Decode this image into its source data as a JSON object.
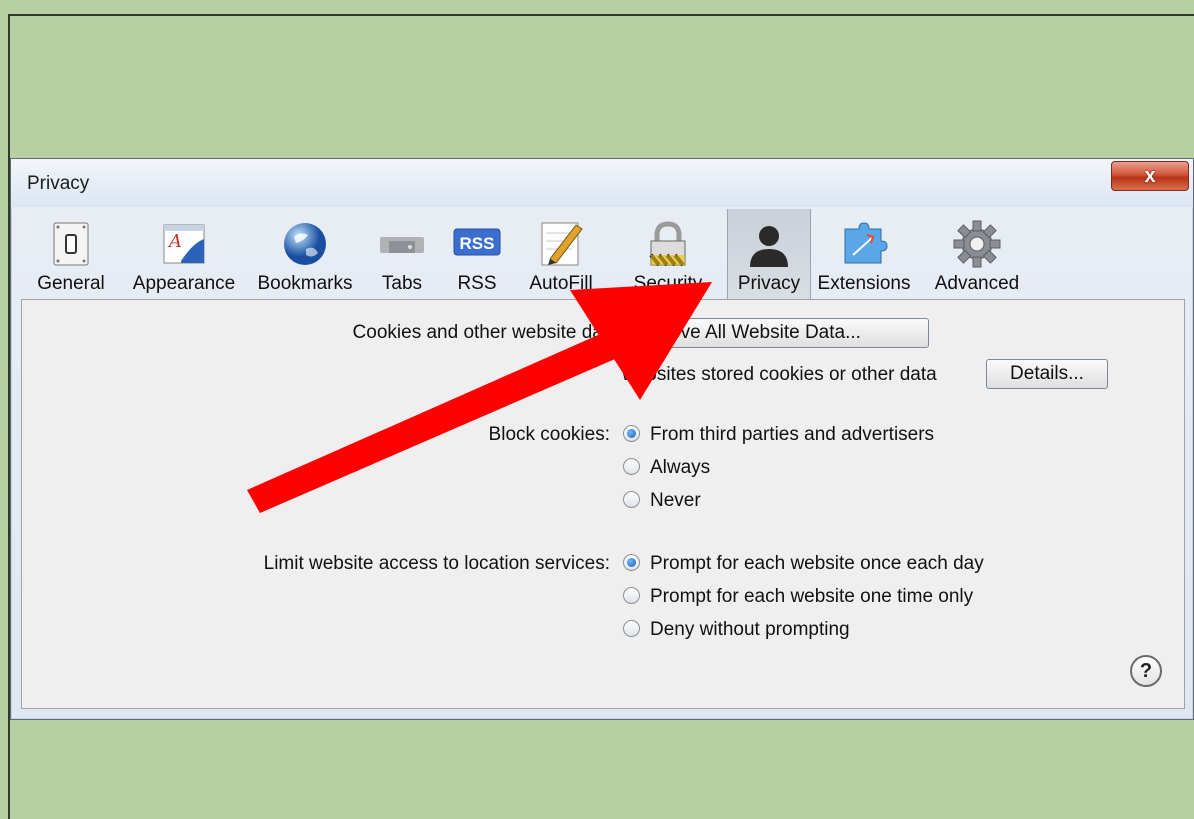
{
  "window": {
    "title": "Privacy",
    "close_glyph": "x"
  },
  "toolbar": {
    "items": [
      {
        "label": "General",
        "icon": "general-switch-icon"
      },
      {
        "label": "Appearance",
        "icon": "appearance-icon"
      },
      {
        "label": "Bookmarks",
        "icon": "globe-icon"
      },
      {
        "label": "Tabs",
        "icon": "tabs-icon"
      },
      {
        "label": "RSS",
        "icon": "rss-icon",
        "icon_text": "RSS"
      },
      {
        "label": "AutoFill",
        "icon": "autofill-pencil-icon"
      },
      {
        "label": "Security",
        "icon": "padlock-icon"
      },
      {
        "label": "Privacy",
        "icon": "person-silhouette-icon",
        "selected": true
      },
      {
        "label": "Extensions",
        "icon": "puzzle-piece-icon"
      },
      {
        "label": "Advanced",
        "icon": "gear-icon"
      }
    ]
  },
  "privacy": {
    "cookies_label": "Cookies and other website data:",
    "remove_all_button": "Remove All Website Data...",
    "stored_count_text": "websites stored cookies or other data",
    "details_button": "Details...",
    "block_cookies_label": "Block cookies:",
    "block_options": [
      {
        "label": "From third parties and advertisers",
        "selected": true
      },
      {
        "label": "Always",
        "selected": false
      },
      {
        "label": "Never",
        "selected": false
      }
    ],
    "location_label": "Limit website access to location services:",
    "location_options": [
      {
        "label": "Prompt for each website once each day",
        "selected": true
      },
      {
        "label": "Prompt for each website one time only",
        "selected": false
      },
      {
        "label": "Deny without prompting",
        "selected": false
      }
    ],
    "help_glyph": "?"
  },
  "colors": {
    "background": "#b7d0a2",
    "annotation_arrow": "#ff0000",
    "radio_selected": "#1a5fb4"
  }
}
